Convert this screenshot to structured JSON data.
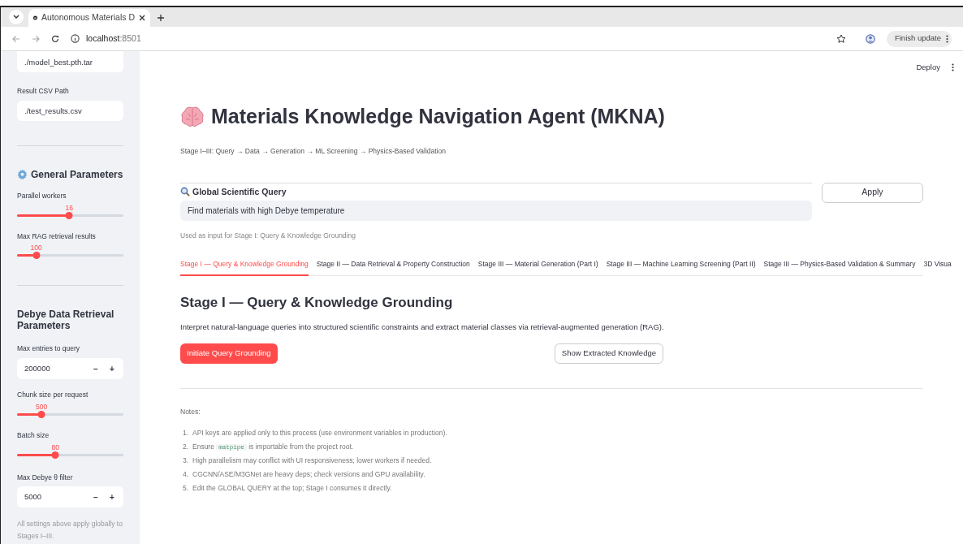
{
  "browser": {
    "tab_title": "Autonomous Materials D",
    "address_host": "localhost",
    "address_port": ":8501",
    "update_button": "Finish update"
  },
  "sidebar": {
    "items": [
      {
        "kind": "text_input",
        "value": "./model_best.pth.tar"
      },
      {
        "kind": "text_input",
        "label": "Result CSV Path",
        "value": "./test_results.csv"
      },
      {
        "kind": "divider"
      },
      {
        "kind": "gear_heading",
        "text": "General Parameters"
      },
      {
        "kind": "slider",
        "label": "Parallel workers",
        "reading": "16",
        "level": 0.49
      },
      {
        "kind": "slider",
        "label": "Max RAG retrieval results",
        "reading": "100",
        "level": 0.18
      },
      {
        "kind": "divider"
      },
      {
        "kind": "heading",
        "text": "Debye Data Retrieval Parameters"
      },
      {
        "kind": "number_input",
        "label": "Max entries to query",
        "value": "200000",
        "minus": "−",
        "plus": "+"
      },
      {
        "kind": "slider",
        "label": "Chunk size per request",
        "reading": "500",
        "level": 0.23
      },
      {
        "kind": "slider",
        "label": "Batch size",
        "reading": "80",
        "level": 0.36
      },
      {
        "kind": "number_input",
        "label": "Max Debye θ filter",
        "value": "5000",
        "minus": "−",
        "plus": "+"
      },
      {
        "kind": "caption",
        "text": "All settings above apply globally to Stages I–III."
      }
    ]
  },
  "header": {
    "deploy": "Deploy"
  },
  "main": {
    "title": "Materials Knowledge Navigation Agent (MKNA)",
    "subtitle": "Stage I–III: Query → Data → Generation → ML Screening → Physics-Based Validation",
    "query": {
      "label": "Global Scientific Query",
      "value": "Find materials with high Debye temperature",
      "help": "Used as input for Stage I: Query & Knowledge Grounding",
      "apply": "Apply"
    },
    "tabs": [
      {
        "label": "Stage I — Query & Knowledge Grounding",
        "selected": true
      },
      {
        "label": "Stage II — Data Retrieval & Property Construction",
        "selected": false
      },
      {
        "label": "Stage III — Material Generation (Part I)",
        "selected": false
      },
      {
        "label": "Stage III — Machine Learning Screening (Part II)",
        "selected": false
      },
      {
        "label": "Stage III — Physics-Based Validation & Summary",
        "selected": false
      },
      {
        "label": "3D Visua",
        "selected": false
      }
    ],
    "section": {
      "heading": "Stage I — Query & Knowledge Grounding",
      "description": "Interpret natural-language queries into structured scientific constraints and extract material classes via retrieval-augmented generation (RAG).",
      "primary_button": "Initiate Query Grounding",
      "secondary_button": "Show Extracted Knowledge"
    },
    "notes": {
      "title": "Notes:",
      "items": [
        {
          "number": "1.",
          "parts": [
            {
              "kind": "text",
              "text": "API keys are applied only to this process (use environment variables in production)."
            }
          ]
        },
        {
          "number": "2.",
          "parts": [
            {
              "kind": "text",
              "text": "Ensure "
            },
            {
              "kind": "code",
              "text": "matpipe"
            },
            {
              "kind": "text",
              "text": " is importable from the project root."
            }
          ]
        },
        {
          "number": "3.",
          "parts": [
            {
              "kind": "text",
              "text": "High parallelism may conflict with UI responsiveness; lower workers if needed."
            }
          ]
        },
        {
          "number": "4.",
          "parts": [
            {
              "kind": "text",
              "text": "CGCNN/ASE/M3GNet are heavy deps; check versions and GPU availability."
            }
          ]
        },
        {
          "number": "5.",
          "parts": [
            {
              "kind": "text",
              "text": "Edit the GLOBAL QUERY at the top; Stage I consumes it directly."
            }
          ]
        }
      ]
    }
  }
}
